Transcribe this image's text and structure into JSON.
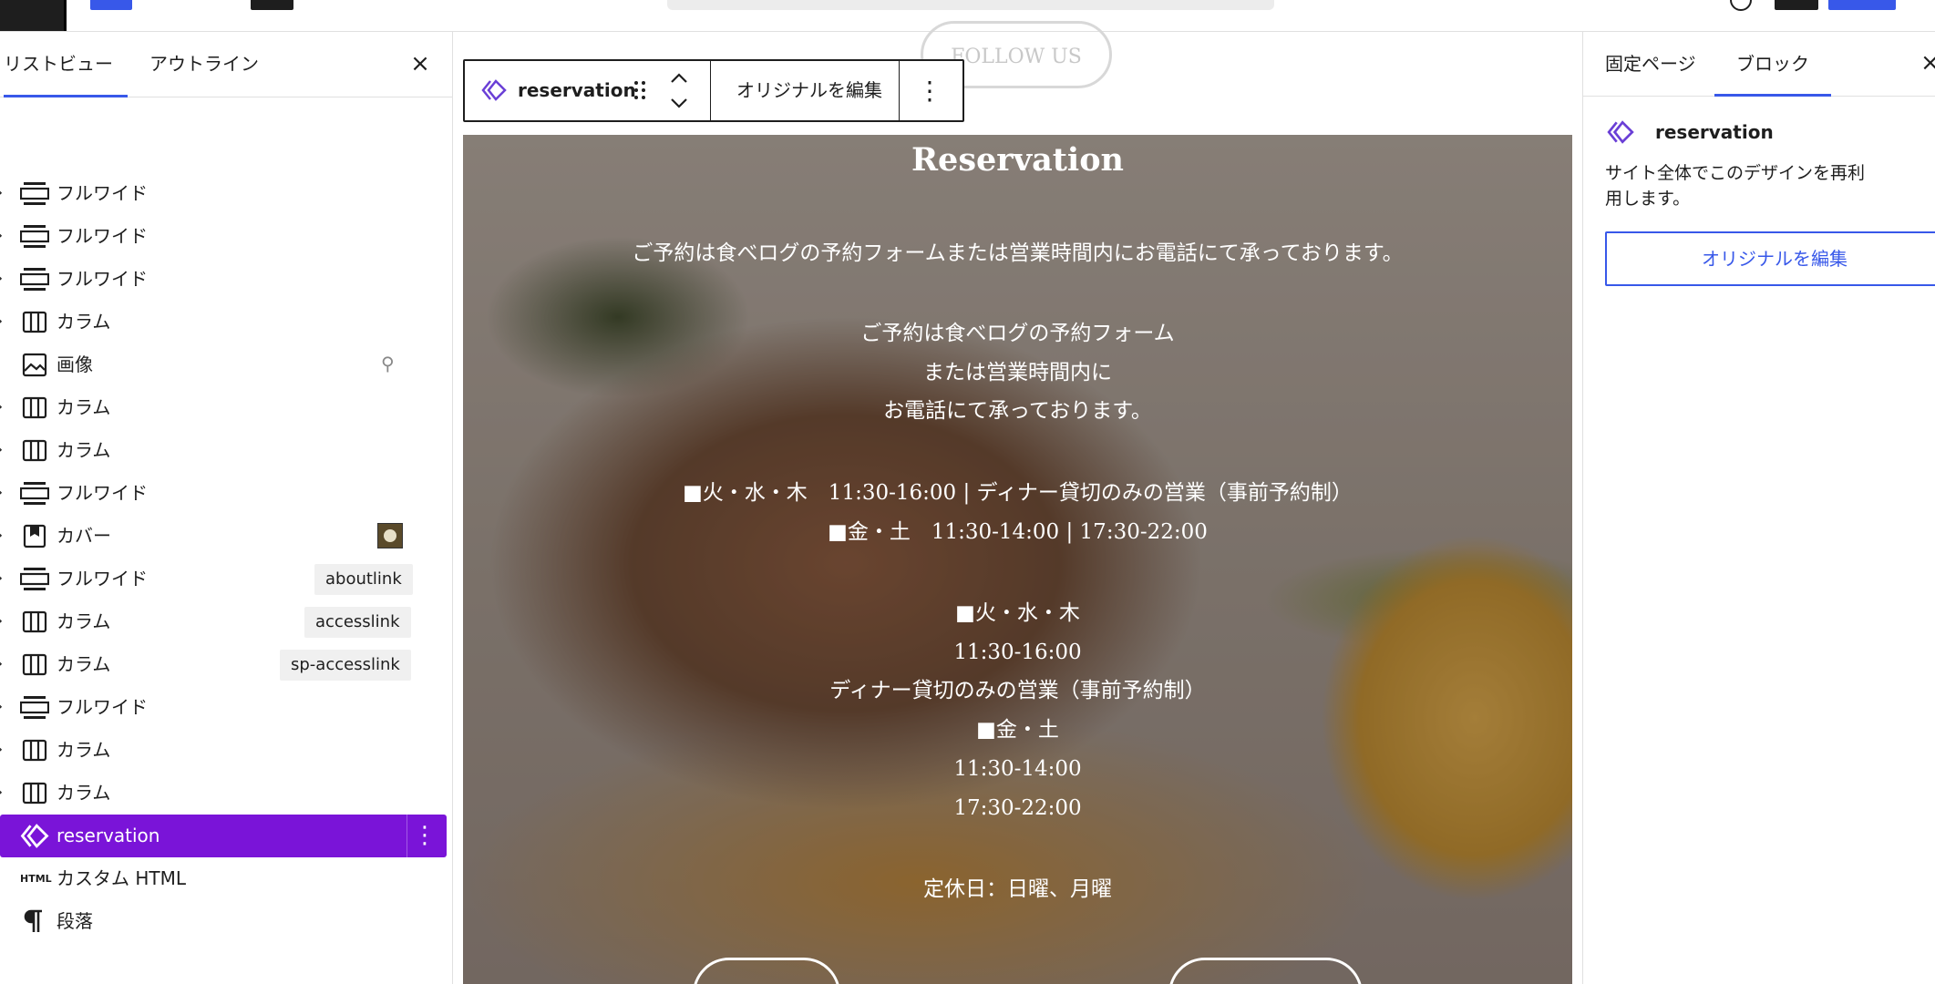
{
  "left_panel": {
    "tabs": [
      "リストビュー",
      "アウトライン"
    ],
    "items": [
      {
        "label": "フルワイド",
        "icon": "group-icon"
      },
      {
        "label": "フルワイド",
        "icon": "group-icon"
      },
      {
        "label": "フルワイド",
        "icon": "group-icon"
      },
      {
        "label": "カラム",
        "icon": "columns-icon"
      },
      {
        "label": "画像",
        "icon": "image-icon"
      },
      {
        "label": "カラム",
        "icon": "columns-icon"
      },
      {
        "label": "カラム",
        "icon": "columns-icon"
      },
      {
        "label": "フルワイド",
        "icon": "group-icon"
      },
      {
        "label": "カバー",
        "icon": "cover-icon"
      },
      {
        "label": "フルワイド",
        "icon": "group-icon",
        "anchor": "aboutlink"
      },
      {
        "label": "カラム",
        "icon": "columns-icon",
        "anchor": "accesslink"
      },
      {
        "label": "カラム",
        "icon": "columns-icon",
        "anchor": "sp-accesslink"
      },
      {
        "label": "フルワイド",
        "icon": "group-icon"
      },
      {
        "label": "カラム",
        "icon": "columns-icon"
      },
      {
        "label": "カラム",
        "icon": "columns-icon"
      },
      {
        "label": "reservation",
        "icon": "synced-pattern-icon",
        "selected": true
      },
      {
        "label": "カスタム HTML",
        "icon": "html-icon"
      },
      {
        "label": "段落",
        "icon": "paragraph-icon"
      }
    ],
    "html_icon_text": "HTML"
  },
  "canvas": {
    "follow_button": "FOLLOW US",
    "toolbar": {
      "block_name": "reservation",
      "edit_original": "オリジナルを編集"
    },
    "cover": {
      "title": "Reservation",
      "lines": [
        "ご予約は食べログの予約フォームまたは営業時間内にお電話にて承っております。",
        "ご予約は食べログの予約フォーム",
        "または営業時間内に",
        "お電話にて承っております。",
        "■火・水・木　11:30-16:00 | ディナー貸切のみの営業（事前予約制）",
        "■金・土　11:30-14:00 | 17:30-22:00",
        "■火・水・木",
        "11:30-16:00",
        "ディナー貸切のみの営業（事前予約制）",
        "■金・土",
        "11:30-14:00",
        "17:30-22:00",
        "定休日：日曜、月曜"
      ]
    }
  },
  "right_panel": {
    "tabs": [
      "固定ページ",
      "ブロック"
    ],
    "block_name": "reservation",
    "description": "サイト全体でこのデザインを再利用します。",
    "edit_original": "オリジナルを編集"
  },
  "colors": {
    "accent": "#3858e9",
    "selected": "#7a14d8"
  }
}
